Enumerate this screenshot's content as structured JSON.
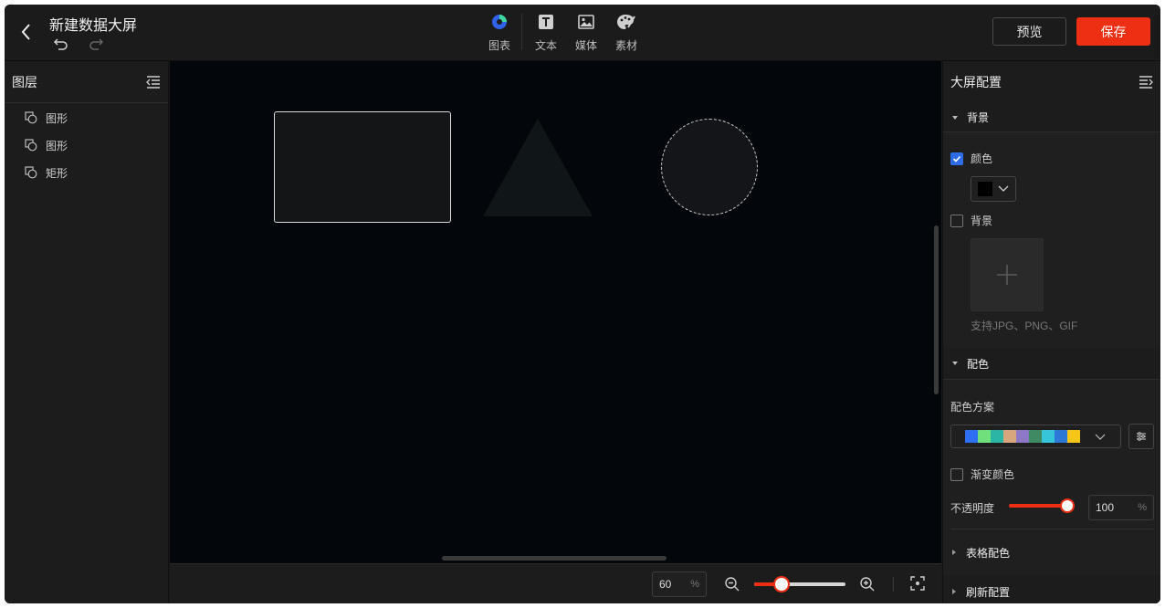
{
  "header": {
    "title": "新建数据大屏",
    "tools": [
      {
        "label": "图表",
        "icon": "chart-icon"
      },
      {
        "label": "文本",
        "icon": "text-icon"
      },
      {
        "label": "媒体",
        "icon": "image-icon"
      },
      {
        "label": "素材",
        "icon": "palette-icon"
      }
    ],
    "preview_label": "预览",
    "save_label": "保存"
  },
  "layers": {
    "title": "图层",
    "items": [
      {
        "label": "图形"
      },
      {
        "label": "图形"
      },
      {
        "label": "矩形"
      }
    ]
  },
  "bottombar": {
    "zoom_value": "60",
    "zoom_unit": "%",
    "zoom_slider_fraction": 0.26
  },
  "config": {
    "title": "大屏配置",
    "background_section": "背景",
    "color_label": "颜色",
    "color_checked": true,
    "color_value": "#000000",
    "bg_image_label": "背景",
    "bg_image_checked": false,
    "upload_hint": "支持JPG、PNG、GIF",
    "palette_section": "配色",
    "palette_scheme_label": "配色方案",
    "palette_colors": [
      "#2f6ff2",
      "#6fe07b",
      "#2bb5a5",
      "#d8a67d",
      "#8d78c8",
      "#3f8a62",
      "#37c6d9",
      "#2d78d6",
      "#f5c518"
    ],
    "gradient_label": "渐变颜色",
    "gradient_checked": false,
    "opacity_label": "不透明度",
    "opacity_value": "100",
    "opacity_unit": "%",
    "table_color_section": "表格配色",
    "refresh_section": "刷新配置"
  },
  "colors": {
    "accent": "#ee2f14",
    "check": "#2e6be6",
    "chart_blue": "#2f62e8",
    "chart_green": "#3fd6a0"
  }
}
